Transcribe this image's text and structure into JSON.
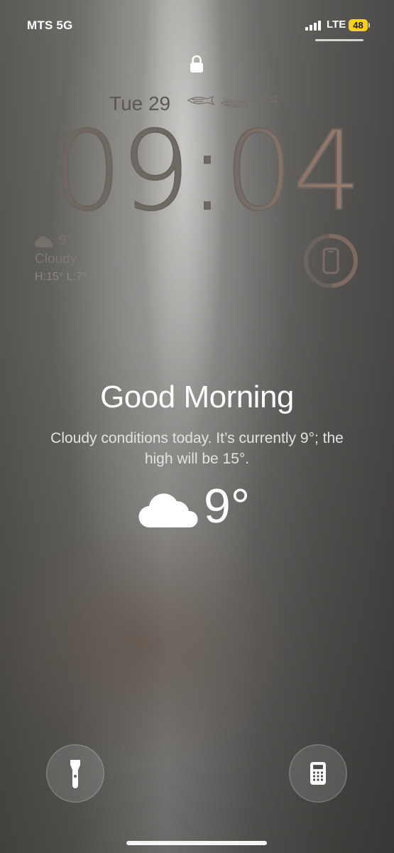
{
  "status_bar": {
    "carrier": "MTS 5G",
    "network": "LTE",
    "battery_level": "48",
    "signal_bars_active": 4,
    "battery_color": "#f5cf1b"
  },
  "lock": {
    "icon": "lock-icon"
  },
  "date": {
    "text": "Tue 29"
  },
  "clock": {
    "time": "09:04"
  },
  "weather_widget": {
    "icon": "cloud-icon",
    "temp": "9°",
    "condition": "Cloudy",
    "high_low": "H:15° L:7°"
  },
  "battery_widget": {
    "icon": "iphone-icon",
    "level_fraction": 0.48
  },
  "greeting": {
    "title": "Good Morning",
    "summary": "Cloudy conditions today. It’s currently 9°; the high will be 15°.",
    "temp": "9°",
    "icon": "cloud-icon"
  },
  "quick_actions": {
    "left_icon": "flashlight-icon",
    "right_icon": "calculator-icon"
  }
}
